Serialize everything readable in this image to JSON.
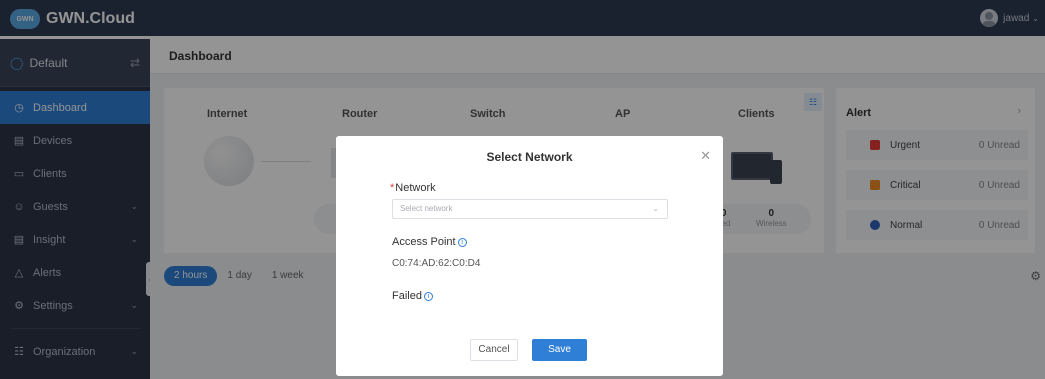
{
  "app": {
    "logo_badge": "GWN",
    "title": "GWN.Cloud",
    "user": "jawad"
  },
  "sidebar": {
    "network": "Default",
    "items": [
      {
        "label": "Dashboard",
        "icon": "dashboard-icon",
        "active": true
      },
      {
        "label": "Devices",
        "icon": "devices-icon"
      },
      {
        "label": "Clients",
        "icon": "clients-icon"
      },
      {
        "label": "Guests",
        "icon": "guests-icon",
        "expandable": true
      },
      {
        "label": "Insight",
        "icon": "insight-icon",
        "expandable": true
      },
      {
        "label": "Alerts",
        "icon": "bell-icon"
      },
      {
        "label": "Settings",
        "icon": "gear-icon",
        "expandable": true
      },
      {
        "label": "Organization",
        "icon": "organization-icon",
        "expandable": true
      }
    ]
  },
  "main": {
    "title": "Dashboard",
    "topology": {
      "headers": [
        "Internet",
        "Router",
        "Switch",
        "AP",
        "Clients"
      ],
      "clients_stats": [
        {
          "value": "0",
          "label": "ired"
        },
        {
          "value": "0",
          "label": "Wireless"
        }
      ]
    },
    "alert": {
      "title": "Alert",
      "rows": [
        {
          "label": "Urgent",
          "count": "0 Unread",
          "color": "#e53935"
        },
        {
          "label": "Critical",
          "count": "0 Unread",
          "color": "#f08a24"
        },
        {
          "label": "Normal",
          "count": "0 Unread",
          "color": "#2f5fb8"
        }
      ]
    },
    "time_tabs": [
      "2 hours",
      "1 day",
      "1 week"
    ]
  },
  "modal": {
    "title": "Select Network",
    "network_label": "Network",
    "network_required": "*",
    "network_placeholder": "Select network",
    "access_point_label": "Access Point",
    "access_point_value": "C0:74:AD:62:C0:D4",
    "failed_label": "Failed",
    "cancel": "Cancel",
    "save": "Save"
  },
  "colors": {
    "primary": "#2f7fd6",
    "sidebar": "#2b3447",
    "topbar": "#2f3b52"
  }
}
